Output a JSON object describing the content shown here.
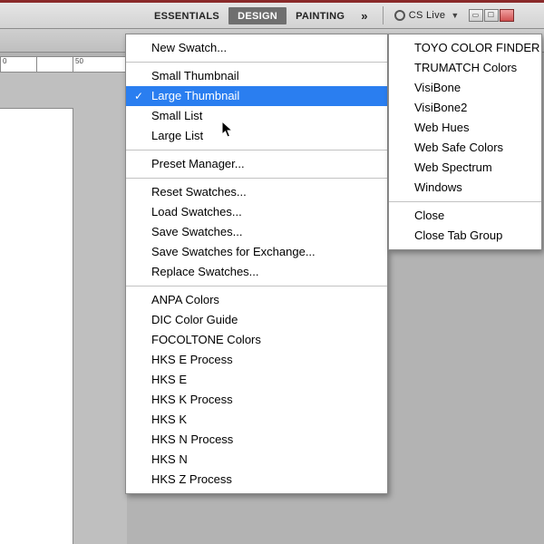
{
  "top_bar": {
    "workspaces": [
      "ESSENTIALS",
      "DESIGN",
      "PAINTING"
    ],
    "active_index": 1,
    "more_glyph": "»",
    "cslive_label": "CS Live"
  },
  "menu_left": {
    "groups": [
      [
        {
          "label": "New Swatch...",
          "checked": false,
          "selected": false
        }
      ],
      [
        {
          "label": "Small Thumbnail",
          "checked": false,
          "selected": false
        },
        {
          "label": "Large Thumbnail",
          "checked": true,
          "selected": true
        },
        {
          "label": "Small List",
          "checked": false,
          "selected": false
        },
        {
          "label": "Large List",
          "checked": false,
          "selected": false
        }
      ],
      [
        {
          "label": "Preset Manager...",
          "checked": false,
          "selected": false
        }
      ],
      [
        {
          "label": "Reset Swatches...",
          "checked": false,
          "selected": false
        },
        {
          "label": "Load Swatches...",
          "checked": false,
          "selected": false
        },
        {
          "label": "Save Swatches...",
          "checked": false,
          "selected": false
        },
        {
          "label": "Save Swatches for Exchange...",
          "checked": false,
          "selected": false
        },
        {
          "label": "Replace Swatches...",
          "checked": false,
          "selected": false
        }
      ],
      [
        {
          "label": "ANPA Colors",
          "checked": false,
          "selected": false
        },
        {
          "label": "DIC Color Guide",
          "checked": false,
          "selected": false
        },
        {
          "label": "FOCOLTONE Colors",
          "checked": false,
          "selected": false
        },
        {
          "label": "HKS E Process",
          "checked": false,
          "selected": false
        },
        {
          "label": "HKS E",
          "checked": false,
          "selected": false
        },
        {
          "label": "HKS K Process",
          "checked": false,
          "selected": false
        },
        {
          "label": "HKS K",
          "checked": false,
          "selected": false
        },
        {
          "label": "HKS N Process",
          "checked": false,
          "selected": false
        },
        {
          "label": "HKS N",
          "checked": false,
          "selected": false
        },
        {
          "label": "HKS Z Process",
          "checked": false,
          "selected": false
        }
      ]
    ]
  },
  "menu_right": {
    "groups": [
      [
        {
          "label": "TOYO COLOR FINDER"
        },
        {
          "label": "TRUMATCH Colors"
        },
        {
          "label": "VisiBone"
        },
        {
          "label": "VisiBone2"
        },
        {
          "label": "Web Hues"
        },
        {
          "label": "Web Safe Colors"
        },
        {
          "label": "Web Spectrum"
        },
        {
          "label": "Windows"
        }
      ],
      [
        {
          "label": "Close"
        },
        {
          "label": "Close Tab Group"
        }
      ]
    ]
  },
  "ruler_ticks": [
    "0",
    "",
    "50"
  ]
}
